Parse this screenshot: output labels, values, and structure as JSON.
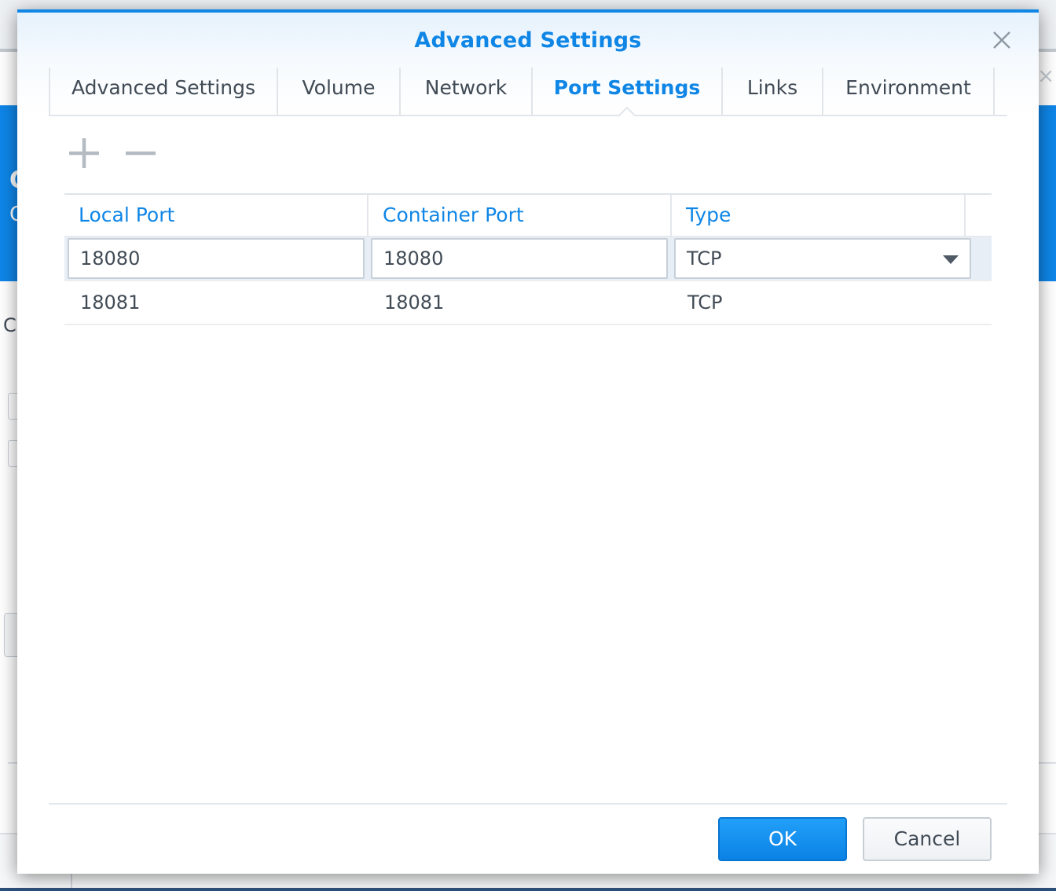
{
  "background": {
    "blue_text_1": "C",
    "blue_text_2": "C",
    "body_text": "C",
    "close_symbol": "×"
  },
  "dialog": {
    "title": "Advanced Settings",
    "close_icon": "close-icon"
  },
  "tabs": [
    {
      "label": "Advanced Settings",
      "active": false
    },
    {
      "label": "Volume",
      "active": false
    },
    {
      "label": "Network",
      "active": false
    },
    {
      "label": "Port Settings",
      "active": true
    },
    {
      "label": "Links",
      "active": false
    },
    {
      "label": "Environment",
      "active": false
    }
  ],
  "toolbar": {
    "add_icon": "plus-icon",
    "remove_icon": "minus-icon"
  },
  "grid": {
    "columns": [
      "Local Port",
      "Container Port",
      "Type"
    ],
    "rows": [
      {
        "local_port": "18080",
        "container_port": "18080",
        "type": "TCP",
        "editing": true
      },
      {
        "local_port": "18081",
        "container_port": "18081",
        "type": "TCP",
        "editing": false
      }
    ]
  },
  "footer": {
    "ok_label": "OK",
    "cancel_label": "Cancel"
  },
  "colors": {
    "accent": "#0f86e6",
    "text": "#414b55",
    "border": "#c7d0d9"
  }
}
